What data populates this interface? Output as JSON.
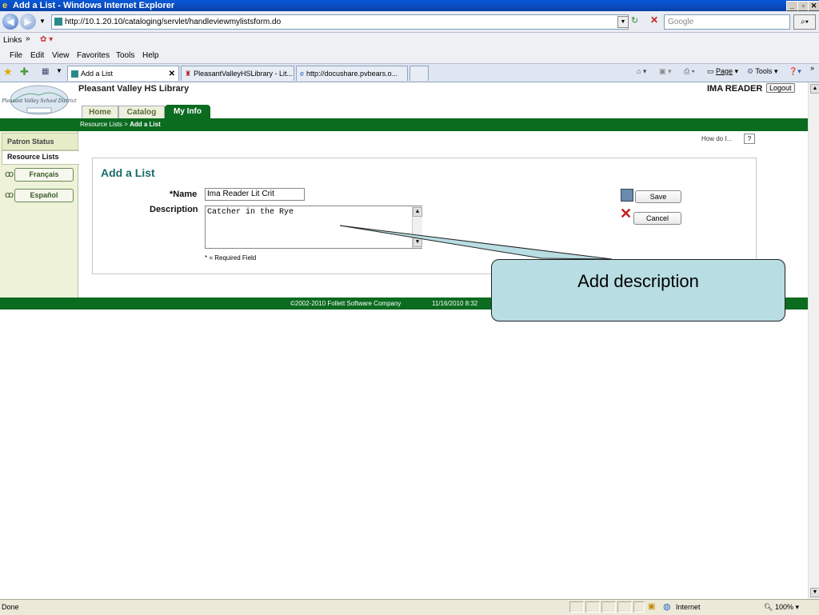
{
  "window": {
    "title": "Add a List - Windows Internet Explorer"
  },
  "address": {
    "url": "http://10.1.20.10/cataloging/servlet/handleviewmylistsform.do",
    "search_placeholder": "Google"
  },
  "links_label": "Links",
  "menu": [
    "File",
    "Edit",
    "View",
    "Favorites",
    "Tools",
    "Help"
  ],
  "tabs": [
    {
      "label": "Add a List"
    },
    {
      "label": "PleasantValleyHSLibrary - Lit..."
    },
    {
      "label": "http://docushare.pvbears.o..."
    }
  ],
  "toolbar_right": {
    "page": "Page",
    "tools": "Tools"
  },
  "site": {
    "logo_text": "Pleasant Valley School District",
    "library_name": "Pleasant Valley HS Library",
    "user": "IMA READER",
    "logout": "Logout",
    "nav_tabs": [
      "Home",
      "Catalog",
      "My Info"
    ],
    "breadcrumb_parent": "Resource Lists",
    "breadcrumb_sep": ">",
    "breadcrumb_current": "Add a List",
    "help": "How do I...",
    "help_icon": "?"
  },
  "sidebar": {
    "patron_status": "Patron Status",
    "resource_lists": "Resource Lists",
    "languages": [
      "Français",
      "Español"
    ]
  },
  "form": {
    "heading": "Add a List",
    "name_label": "*Name",
    "name_value": "Ima Reader Lit Crit",
    "description_label": "Description",
    "description_value": "Catcher in the Rye",
    "required_note": "* = Required Field",
    "save": "Save",
    "cancel": "Cancel"
  },
  "footer": {
    "copyright": "©2002-2010  Follett Software Company",
    "datetime": "11/16/2010 8:32"
  },
  "callout": {
    "text": "Add description"
  },
  "status": {
    "left": "Done",
    "zone": "Internet",
    "zoom": "100%"
  },
  "colors": {
    "green": "#0b6b1f",
    "teal_text": "#1d6a6a",
    "callout_bg": "#b8dde3"
  }
}
